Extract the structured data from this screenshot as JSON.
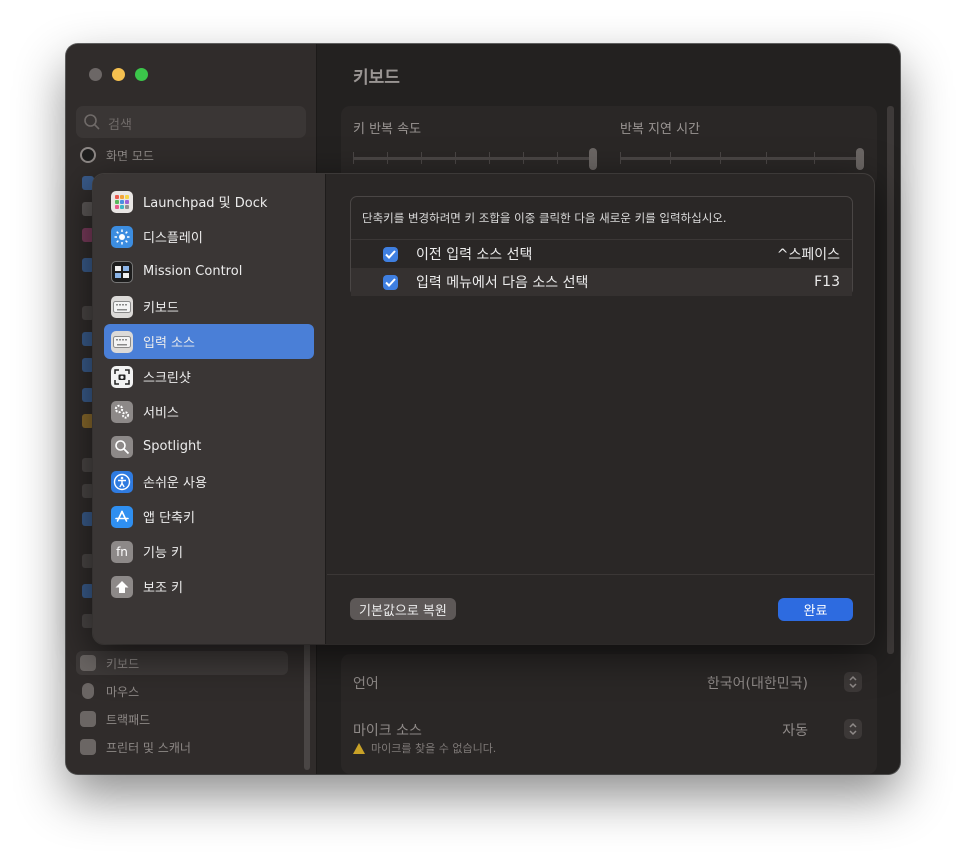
{
  "window": {
    "title": "키보드",
    "search_placeholder": "검색"
  },
  "sidebar": {
    "top_item": "화면 모드",
    "bottom_items": [
      {
        "label": "키보드",
        "icon": "keyboard-icon"
      },
      {
        "label": "마우스",
        "icon": "mouse-icon"
      },
      {
        "label": "트랙패드",
        "icon": "trackpad-icon"
      },
      {
        "label": "프린터 및 스캐너",
        "icon": "printer-icon"
      }
    ]
  },
  "main": {
    "key_repeat_label": "키 반복 속도",
    "delay_label": "반복 지연 시간",
    "language_label": "언어",
    "language_value": "한국어(대한민국)",
    "mic_label": "마이크 소스",
    "mic_value": "자동",
    "mic_warning": "마이크를 찾을 수 없습니다."
  },
  "sheet": {
    "categories": [
      {
        "label": "Launchpad 및 Dock",
        "icon": "launchpad-icon"
      },
      {
        "label": "디스플레이",
        "icon": "display-brightness-icon"
      },
      {
        "label": "Mission Control",
        "icon": "mission-control-icon"
      },
      {
        "label": "키보드",
        "icon": "keyboard-icon"
      },
      {
        "label": "입력 소스",
        "icon": "input-source-icon"
      },
      {
        "label": "스크린샷",
        "icon": "screenshot-icon"
      },
      {
        "label": "서비스",
        "icon": "services-gear-icon"
      },
      {
        "label": "Spotlight",
        "icon": "spotlight-search-icon"
      },
      {
        "label": "손쉬운 사용",
        "icon": "accessibility-icon"
      },
      {
        "label": "앱 단축키",
        "icon": "app-store-icon"
      },
      {
        "label": "기능 키",
        "icon": "fn-key-icon"
      },
      {
        "label": "보조 키",
        "icon": "modifier-key-icon"
      }
    ],
    "selected_category": "입력 소스",
    "hint": "단축키를 변경하려면 키 조합을 이중 클릭한 다음 새로운 키를 입력하십시오.",
    "shortcuts": [
      {
        "label": "이전 입력 소스 선택",
        "key": "^스페이스",
        "checked": true
      },
      {
        "label": "입력 메뉴에서 다음 소스 선택",
        "key": "F13",
        "checked": true
      }
    ],
    "reset_label": "기본값으로 복원",
    "done_label": "완료"
  },
  "colors": {
    "accent": "#2d6be0",
    "selection": "#4a7fd7",
    "checkbox": "#3f7fe0",
    "warning": "#c9a227"
  }
}
